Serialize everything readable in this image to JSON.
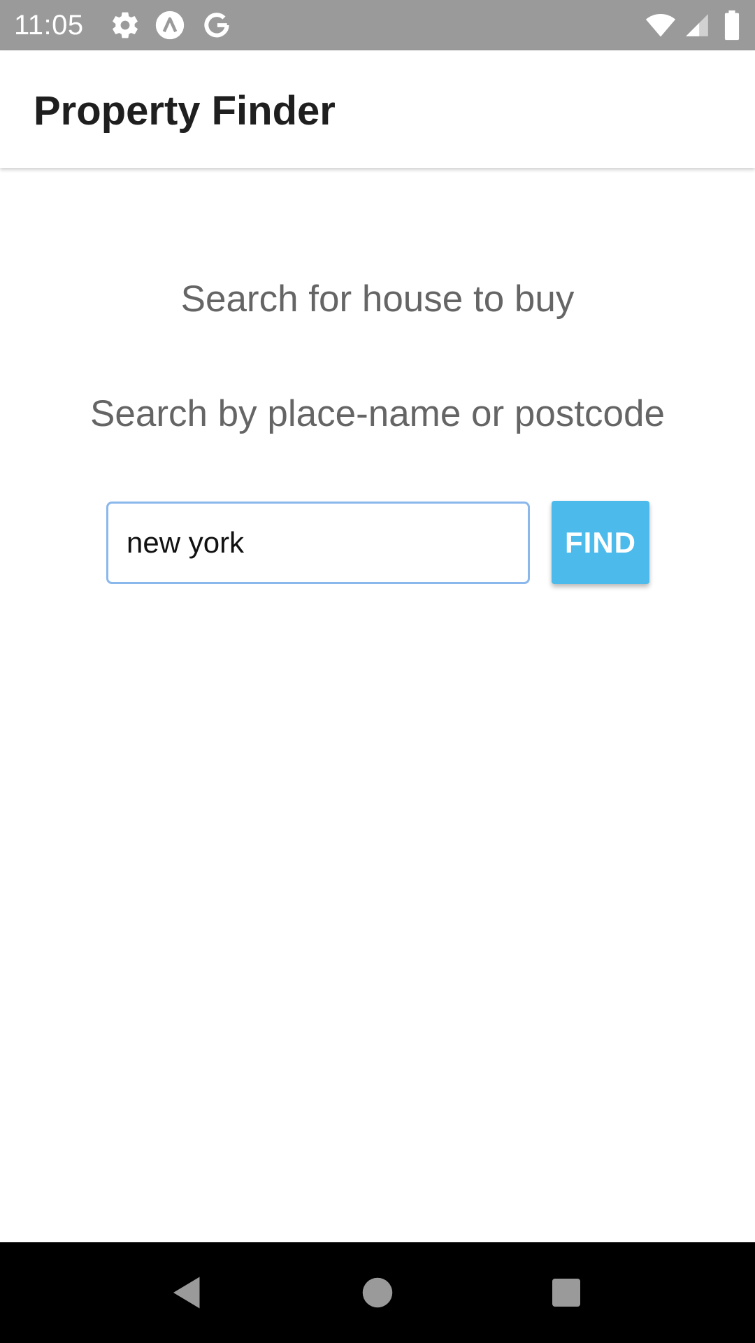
{
  "status_bar": {
    "time": "11:05",
    "icons": [
      "gear-icon",
      "app-a-icon",
      "google-g-icon",
      "wifi-icon",
      "cell-signal-icon",
      "battery-icon"
    ]
  },
  "app_bar": {
    "title": "Property Finder"
  },
  "main": {
    "heading": "Search for house to buy",
    "subheading": "Search by place-name or postcode",
    "search": {
      "value": "new york",
      "placeholder": ""
    },
    "find_button_label": "FIND"
  },
  "nav_bar": {
    "buttons": [
      "back-icon",
      "home-icon",
      "recents-icon"
    ]
  },
  "colors": {
    "status_bar": "#9a9a9a",
    "accent_button": "#4cbbec",
    "input_border": "#8ab7ec",
    "heading_text": "#656565",
    "title_text": "#1f1f1f",
    "nav_bar": "#000000"
  }
}
